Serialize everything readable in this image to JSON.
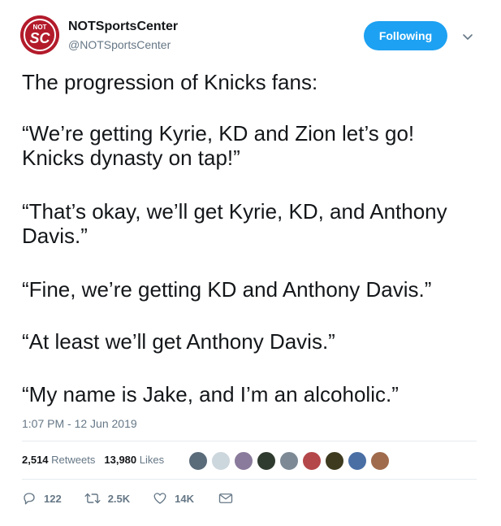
{
  "user": {
    "name": "NOTSportsCenter",
    "handle": "@NOTSportsCenter",
    "avatar_text_top": "NOT",
    "avatar_text_main": "SC"
  },
  "follow": {
    "label": "Following"
  },
  "tweet": {
    "lines": [
      "The progression of Knicks fans:",
      "“We’re getting Kyrie, KD and Zion let’s go!",
      "Knicks dynasty on tap!”",
      "“That’s okay, we’ll get Kyrie, KD, and Anthony",
      "Davis.”",
      "“Fine, we’re getting KD and Anthony Davis.”",
      "“At least we’ll get Anthony Davis.”",
      "“My name is Jake, and I’m an alcoholic.”"
    ],
    "timestamp": "1:07 PM - 12 Jun 2019"
  },
  "stats": {
    "retweets_count": "2,514",
    "retweets_label": "Retweets",
    "likes_count": "13,980",
    "likes_label": "Likes"
  },
  "actions": {
    "reply_count": "122",
    "retweet_count": "2.5K",
    "like_count": "14K"
  },
  "colors": {
    "accent": "#1da1f2",
    "avatar_bg": "#b31b2b",
    "secondary_text": "#657786",
    "divider": "#e6ecf0"
  }
}
